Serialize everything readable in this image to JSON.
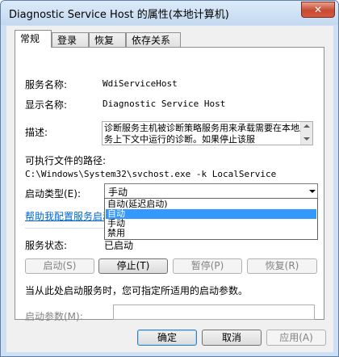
{
  "window": {
    "title": "Diagnostic Service Host 的属性(本地计算机)",
    "close_glyph": "✕"
  },
  "tabs": [
    {
      "label": "常规",
      "active": true
    },
    {
      "label": "登录",
      "active": false
    },
    {
      "label": "恢复",
      "active": false
    },
    {
      "label": "依存关系",
      "active": false
    }
  ],
  "general": {
    "service_name_label": "服务名称:",
    "service_name_value": "WdiServiceHost",
    "display_name_label": "显示名称:",
    "display_name_value": "Diagnostic Service Host",
    "description_label": "描述:",
    "description_value": "诊断服务主机被诊断策略服务用来承载需要在本地服务上下文中运行的诊断。如果停止该服",
    "exe_path_label": "可执行文件的路径:",
    "exe_path_value": "C:\\Windows\\System32\\svchost.exe -k LocalService",
    "startup_type_label": "启动类型(E):",
    "startup_type_value": "手动",
    "startup_options": [
      "自动(延迟启动)",
      "自动",
      "手动",
      "禁用"
    ],
    "startup_selected_index": 1,
    "help_link": "帮助我配置服务启动选项。",
    "service_status_label": "服务状态:",
    "service_status_value": "已启动",
    "start_button": "启动(S)",
    "stop_button": "停止(T)",
    "pause_button": "暂停(P)",
    "resume_button": "恢复(R)",
    "hint_text": "当从此处启动服务时，您可指定所适用的启动参数。",
    "start_params_label": "启动参数(M):",
    "start_params_value": ""
  },
  "footer": {
    "ok_button": "确定",
    "cancel_button": "取消",
    "apply_button": "应用(A)"
  }
}
